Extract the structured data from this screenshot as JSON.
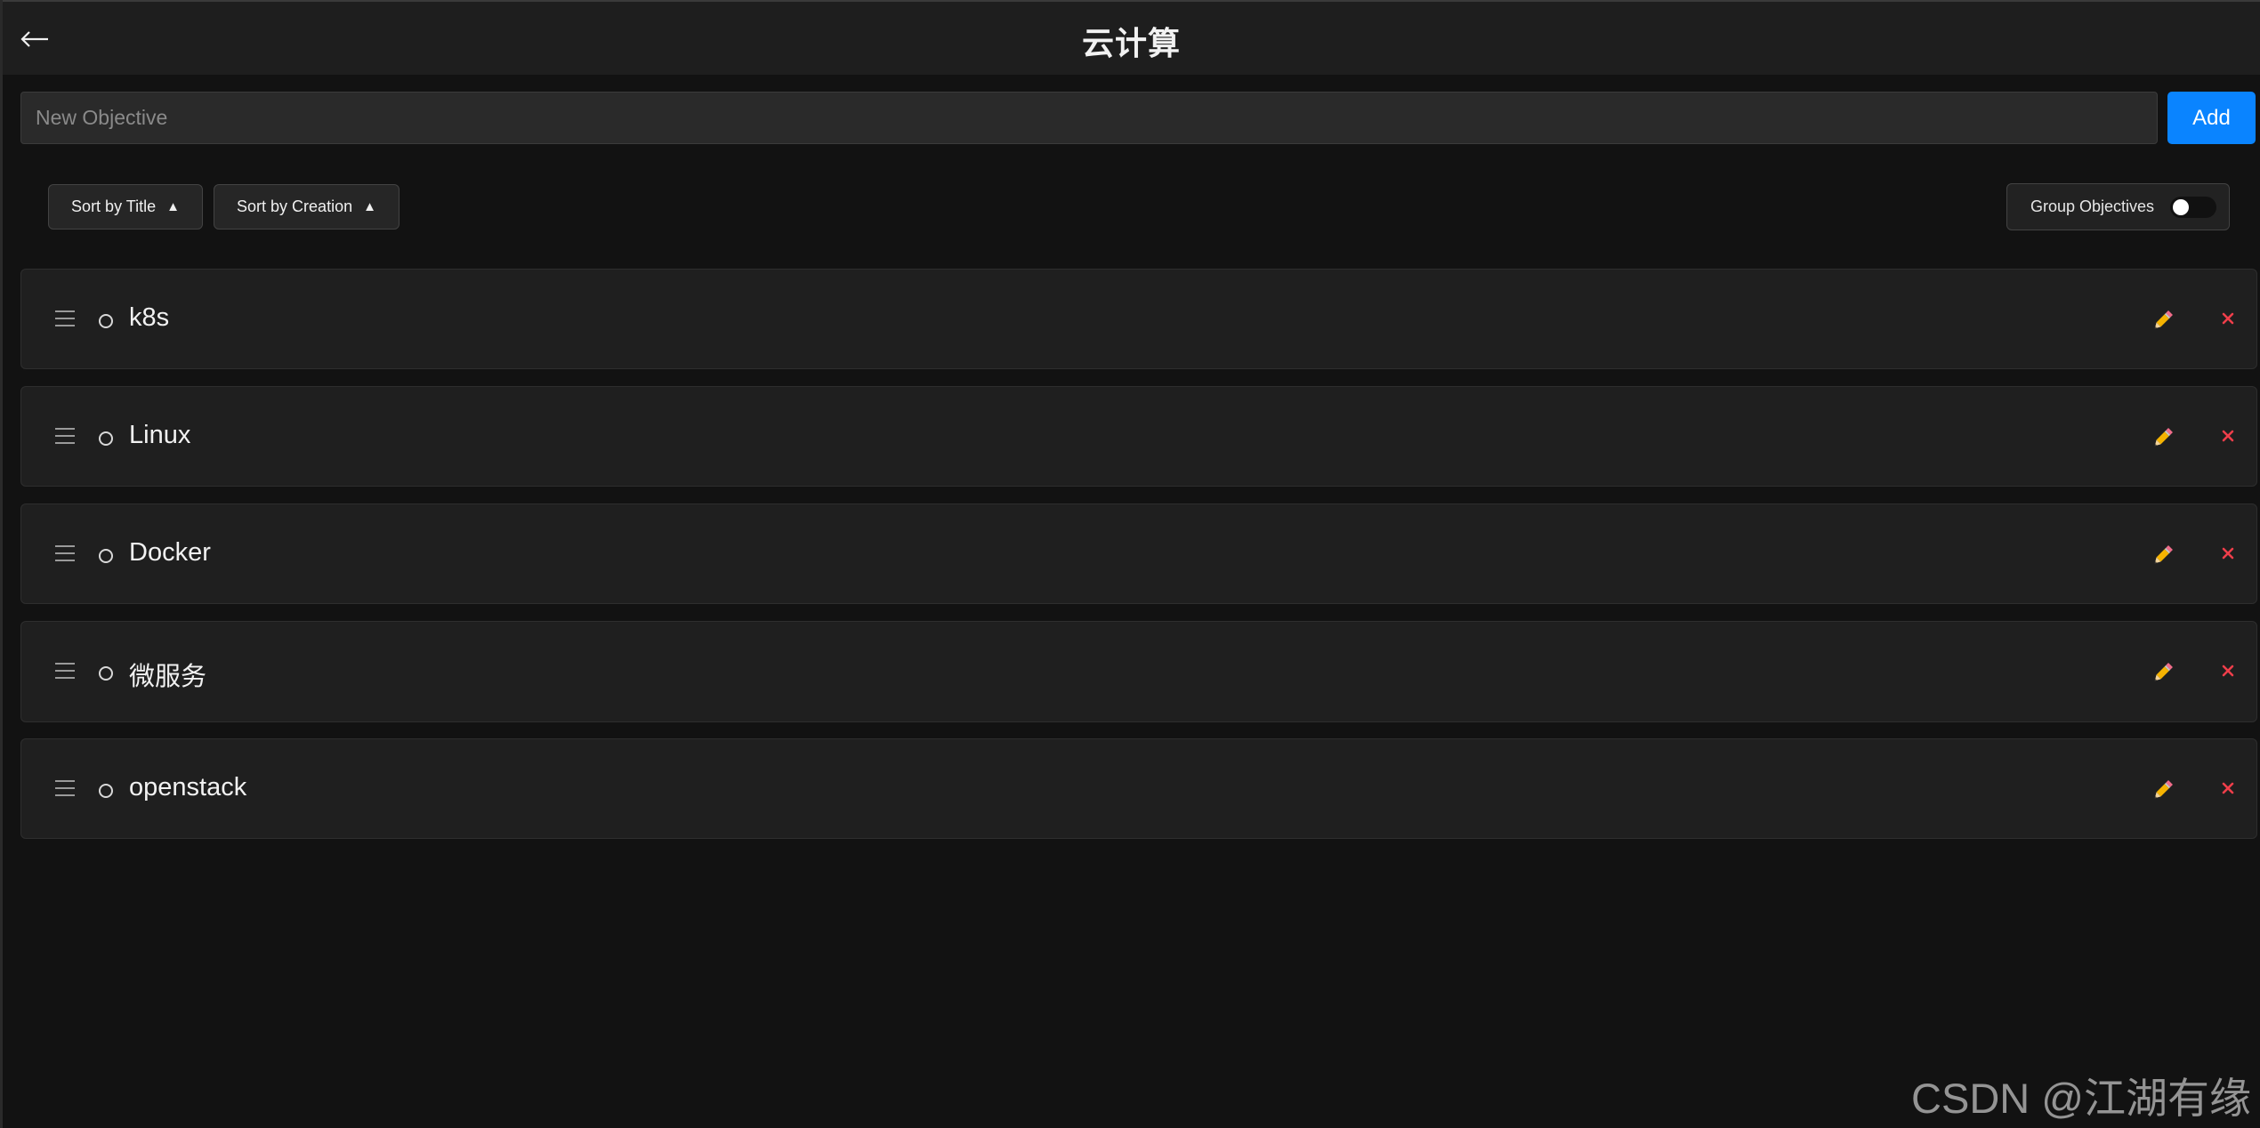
{
  "header": {
    "title": "云计算",
    "back_icon": "arrow-left-icon"
  },
  "add_form": {
    "input_value": "",
    "input_placeholder": "New Objective",
    "add_label": "Add"
  },
  "controls": {
    "sort_title_label": "Sort by Title",
    "sort_title_direction": "▲",
    "sort_creation_label": "Sort by Creation",
    "sort_creation_direction": "▲",
    "group_label": "Group Objectives",
    "group_enabled": false
  },
  "objectives": [
    {
      "title": "k8s",
      "done": false
    },
    {
      "title": "Linux",
      "done": false
    },
    {
      "title": "Docker",
      "done": false
    },
    {
      "title": "微服务",
      "done": false
    },
    {
      "title": "openstack",
      "done": false
    }
  ],
  "item_icons": {
    "drag": "drag-handle-icon",
    "status": "circle-icon",
    "edit": "pencil-icon",
    "delete": "close-icon"
  },
  "colors": {
    "background": "#121212",
    "surface": "#1f1f1f",
    "accent": "#0a84ff",
    "edit": "#f5b301",
    "delete": "#ef3e4a"
  },
  "watermark": "CSDN @江湖有缘"
}
